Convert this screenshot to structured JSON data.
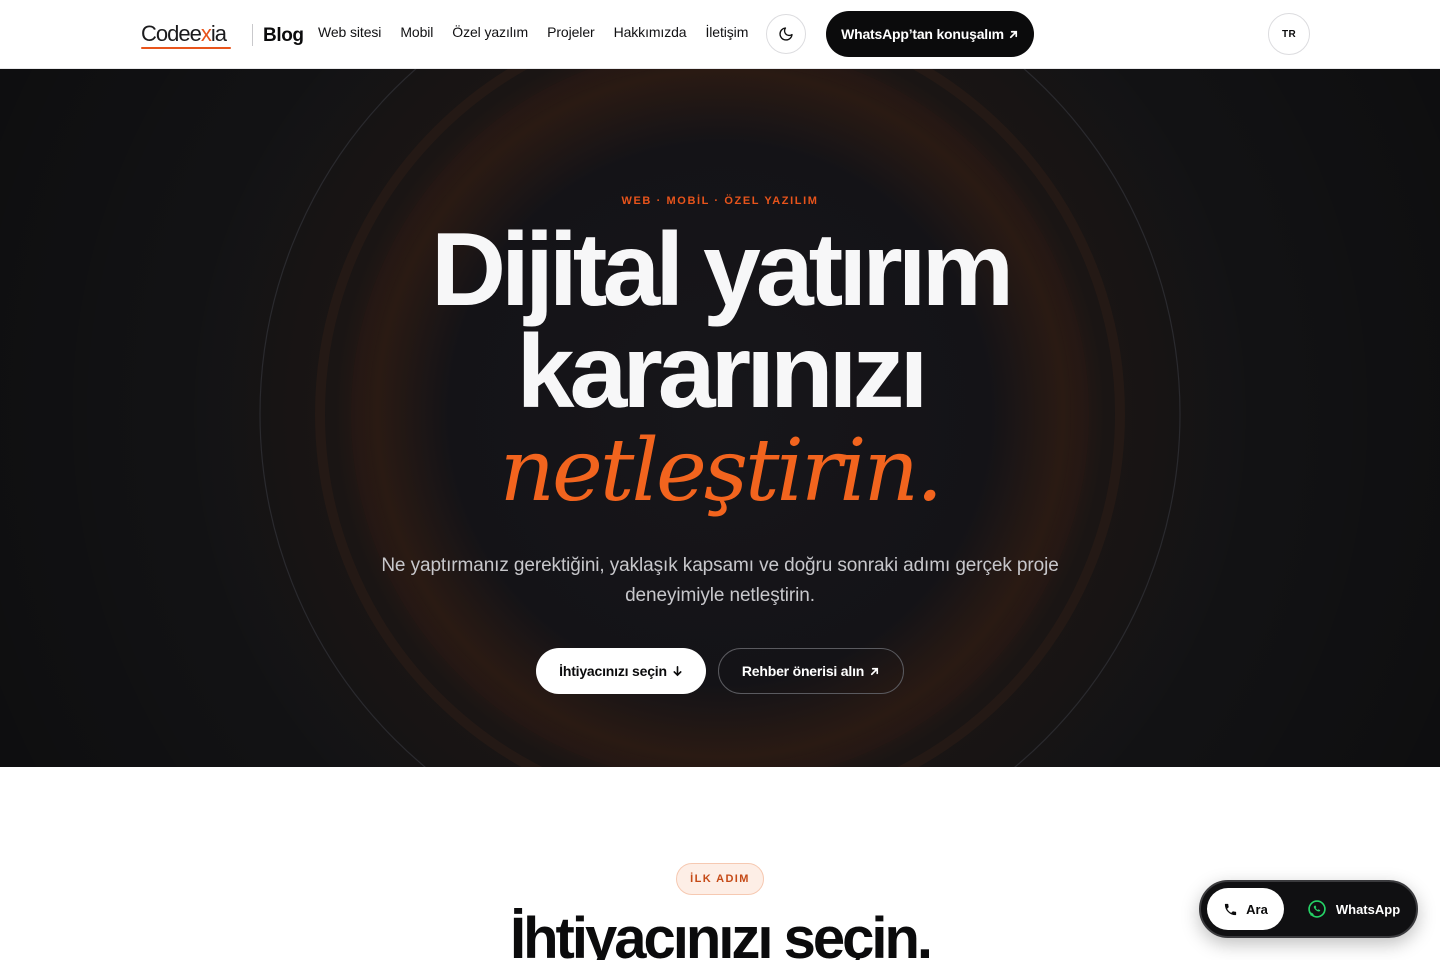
{
  "header": {
    "logo": {
      "main": "Codee",
      "accent": "x",
      "rest": "ia"
    },
    "section_label": "Blog",
    "nav": [
      {
        "label": "Web sitesi"
      },
      {
        "label": "Mobil"
      },
      {
        "label": "Özel yazılım"
      },
      {
        "label": "Projeler"
      },
      {
        "label": "Hakkımızda"
      },
      {
        "label": "İletişim"
      }
    ],
    "theme_toggle_icon": "moon-icon",
    "whatsapp_cta": "WhatsApp’tan konuşalım",
    "language": "TR"
  },
  "hero": {
    "eyebrow": "WEB · MOBİL · ÖZEL YAZILIM",
    "headline_line1": "Dijital yatırım",
    "headline_line2": "kararınızı",
    "headline_accent": "netleştirin.",
    "subtitle": "Ne yaptırmanız gerektiğini, yaklaşık kapsamı ve doğru sonraki adımı gerçek proje deneyimiyle netleştirin.",
    "primary_cta": "İhtiyacınızı seçin",
    "secondary_cta": "Rehber önerisi alın"
  },
  "next_section": {
    "badge": "İLK ADIM",
    "title": "İhtiyacınızı seçin."
  },
  "floating_contact": {
    "call_label": "Ara",
    "whatsapp_label": "WhatsApp"
  },
  "colors": {
    "accent": "#f2641e",
    "hero_bg": "#141416",
    "whatsapp_green": "#25d366"
  }
}
